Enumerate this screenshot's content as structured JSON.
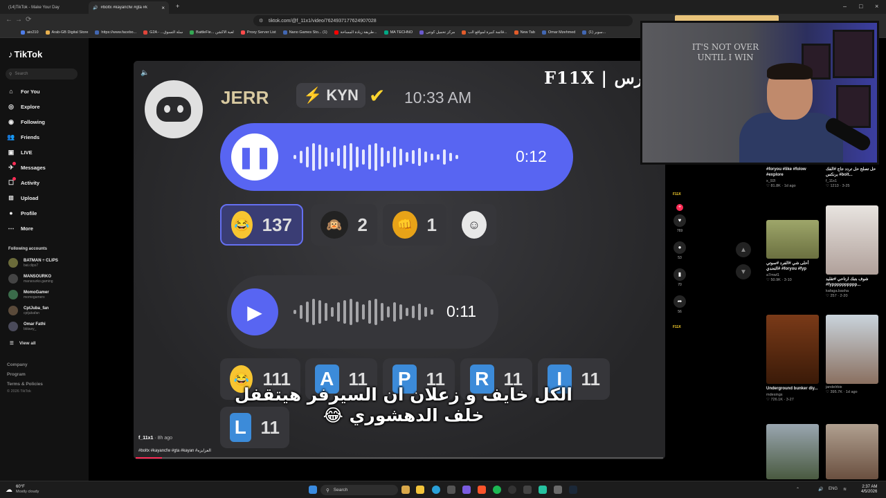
{
  "browser": {
    "tabs": [
      {
        "label": "(14)TikTok - Make Your Day"
      },
      {
        "label": "#boltx #kayancfw #gta #k"
      }
    ],
    "url": "tiktok.com/@f_11x1/video/7624937177624907028",
    "bookmarks": [
      "aio210",
      "Arab-GB Digital Store",
      "https://www.facebo...",
      "G2A - ...سلة التسوق",
      "BattleFie... لعبة الاكشن",
      "Proxy Server List",
      "Nano Games Sto... (1)",
      "طريقة زيادة المساحة...",
      "MA TECHNO",
      "مركز تحميل كوتنى",
      "قائمة كبيرة لمواقع الب...",
      "New Tab",
      "Omar Mzehmed",
      "(1) سوبر..."
    ]
  },
  "sidebar": {
    "logo": "TikTok",
    "search_placeholder": "Search",
    "nav": [
      {
        "label": "For You",
        "icon": "home-icon"
      },
      {
        "label": "Explore",
        "icon": "compass-icon"
      },
      {
        "label": "Following",
        "icon": "following-icon"
      },
      {
        "label": "Friends",
        "icon": "friends-icon"
      },
      {
        "label": "LIVE",
        "icon": "live-icon"
      },
      {
        "label": "Messages",
        "icon": "messages-icon"
      },
      {
        "label": "Activity",
        "icon": "activity-icon"
      },
      {
        "label": "Upload",
        "icon": "upload-icon"
      },
      {
        "label": "Profile",
        "icon": "profile-icon"
      },
      {
        "label": "More",
        "icon": "more-icon"
      }
    ],
    "following_title": "Following accounts",
    "accounts": [
      {
        "name": "BATMAN ÷ CLIPS",
        "handle": "bat.clips7"
      },
      {
        "name": "MANSOURKO",
        "handle": "mansourko.gaming"
      },
      {
        "name": "MomoGamer",
        "handle": "momogamerx"
      },
      {
        "name": "CptJuba_fan",
        "handle": "cptjubafan"
      },
      {
        "name": "Omar Fathi",
        "handle": "bblawy_"
      }
    ],
    "view_all": "View all",
    "footer": [
      "Company",
      "Program",
      "Terms & Policies"
    ],
    "copyright": "© 2026 TikTok"
  },
  "video": {
    "brand": "F11X | فارس",
    "message": {
      "user": "JERR",
      "tag": "KYN",
      "time": "10:33 AM",
      "voice1_time": "0:12",
      "voice2_time": "0:11",
      "reactions1": [
        {
          "emoji": "😂",
          "count": "137"
        },
        {
          "emoji": "🙉",
          "count": "2"
        },
        {
          "emoji": "👊",
          "count": "1"
        }
      ],
      "reactions2": [
        {
          "emoji": "😂",
          "count": "111"
        },
        {
          "letter": "A",
          "count": "11"
        },
        {
          "letter": "P",
          "count": "11"
        },
        {
          "letter": "R",
          "count": "11"
        },
        {
          "letter": "I",
          "count": "11"
        }
      ],
      "reaction_last": {
        "letter": "L",
        "count": "11"
      }
    },
    "caption_ar": "الكل خايف و زعلان ان السيرفر هيتقفل خلف الدهشوري 😂",
    "author": "f_11x1",
    "posted": "8h ago",
    "description": "#boltx #kayancfw #gta #kayan #العزايزه",
    "progress": 0.05
  },
  "actions": [
    {
      "icon": "heart-icon",
      "count": "769"
    },
    {
      "icon": "comment-icon",
      "count": "53"
    },
    {
      "icon": "bookmark-icon",
      "count": "70"
    },
    {
      "icon": "share-icon",
      "count": "56"
    }
  ],
  "rail_logo": "F11X",
  "recommended": [
    {
      "caption": "#foryou #like #folow #explore",
      "author": "x_92l",
      "views": "81.8K",
      "date": "1d ago"
    },
    {
      "caption": "حل تصلح حل تردد جاج #الفك برنكس #bolt...",
      "author": "f_11x1",
      "views": "1213",
      "date": "3-25"
    },
    {
      "caption": "أحلى شي #الفرد #سوتي #التحدي #foryou #fyp",
      "author": "a7mwl1",
      "views": "50.9K",
      "date": "3-10"
    },
    {
      "caption": "شوف بتبك ارتاحي #تقليد #fypppppppppp...",
      "author": "kafaga.basha",
      "views": "257",
      "date": "2-20"
    },
    {
      "caption": "Underground bunker diy...",
      "author": "mdesings",
      "views": "726.1K",
      "date": "3-27"
    },
    {
      "caption": "",
      "author": "jandelrbix",
      "views": "395.7K",
      "date": "1d ago"
    }
  ],
  "webcam": {
    "poster_text": "IT'S NOT OVER UNTIL I WIN"
  },
  "taskbar": {
    "weather_temp": "60°F",
    "weather_desc": "Mostly cloudy",
    "search": "Search",
    "lang": "ENG",
    "time": "2:37 AM",
    "date": "4/5/2026"
  },
  "colors": {
    "accent": "#fe2c55",
    "discord": "#5865f2"
  }
}
